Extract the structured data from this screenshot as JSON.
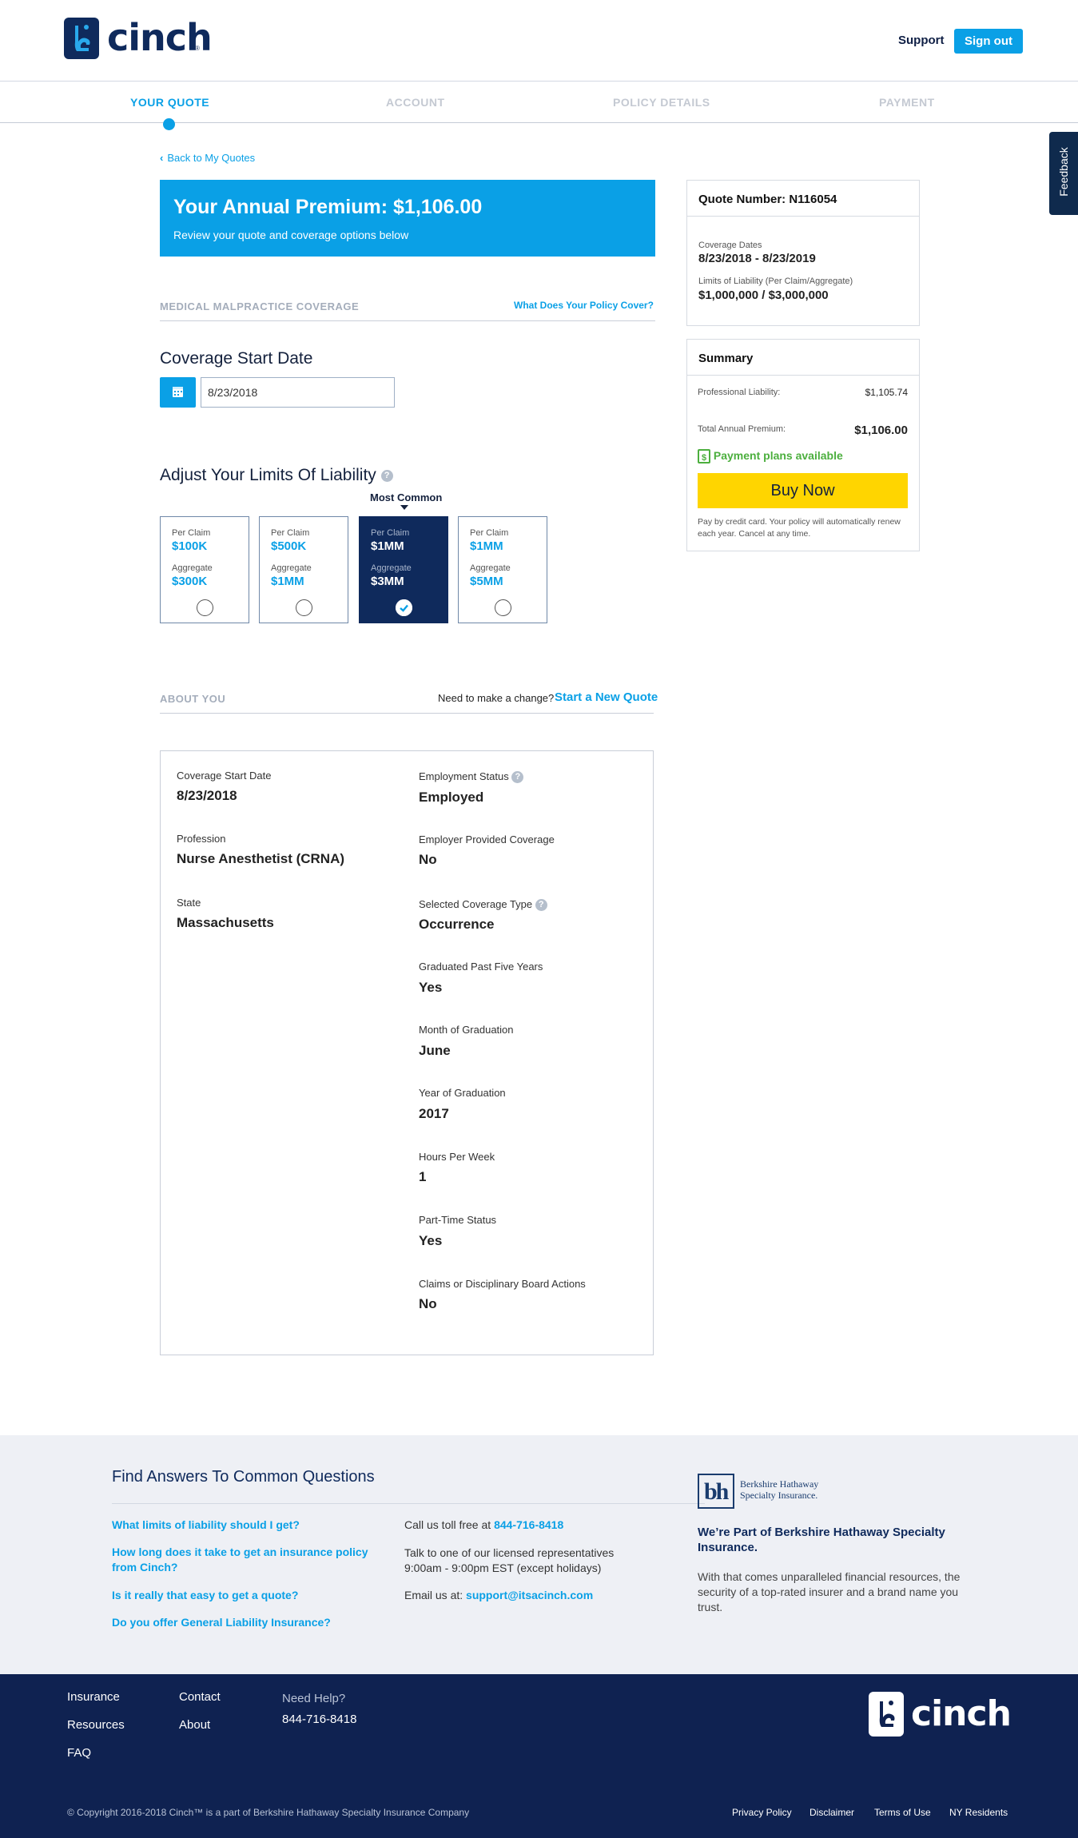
{
  "header": {
    "logo_text": "cinch",
    "logo_tm": "®",
    "support": "Support",
    "sign_out": "Sign out"
  },
  "steps": [
    "YOUR QUOTE",
    "ACCOUNT",
    "POLICY DETAILS",
    "PAYMENT"
  ],
  "feedback": "Feedback",
  "main": {
    "back": "Back to My Quotes",
    "premium_title": "Your Annual Premium: $1,106.00",
    "premium_sub": "Review your quote and coverage options below",
    "coverage_section": "MEDICAL MALPRACTICE COVERAGE",
    "policy_cover_link": "What Does Your Policy Cover?",
    "start_date_title": "Coverage Start Date",
    "start_date_value": "8/23/2018",
    "limits_title": "Adjust Your Limits Of Liability",
    "help": "?",
    "most_common": "Most Common",
    "limits": [
      {
        "per_claim_label": "Per Claim",
        "per_claim": "$100K",
        "aggregate_label": "Aggregate",
        "aggregate": "$300K"
      },
      {
        "per_claim_label": "Per Claim",
        "per_claim": "$500K",
        "aggregate_label": "Aggregate",
        "aggregate": "$1MM"
      },
      {
        "per_claim_label": "Per Claim",
        "per_claim": "$1MM",
        "aggregate_label": "Aggregate",
        "aggregate": "$3MM"
      },
      {
        "per_claim_label": "Per Claim",
        "per_claim": "$1MM",
        "aggregate_label": "Aggregate",
        "aggregate": "$5MM"
      }
    ],
    "about_section": "ABOUT YOU",
    "change_text": "Need to make a change?",
    "new_quote_link": "Start a New Quote"
  },
  "about": {
    "left": [
      {
        "label": "Coverage Start Date",
        "value": "8/23/2018"
      },
      {
        "label": "Profession",
        "value": "Nurse Anesthetist (CRNA)"
      },
      {
        "label": "State",
        "value": "Massachusetts"
      }
    ],
    "right": [
      {
        "label": "Employment Status",
        "value": "Employed"
      },
      {
        "label": "Employer Provided Coverage",
        "value": "No"
      },
      {
        "label": "Selected Coverage Type",
        "value": "Occurrence"
      },
      {
        "label": "Graduated Past Five Years",
        "value": "Yes"
      },
      {
        "label": "Month of Graduation",
        "value": "June"
      },
      {
        "label": "Year of Graduation",
        "value": "2017"
      },
      {
        "label": "Hours Per Week",
        "value": "1"
      },
      {
        "label": "Part-Time Status",
        "value": "Yes"
      },
      {
        "label": "Claims or Disciplinary Board Actions",
        "value": "No"
      }
    ]
  },
  "quote": {
    "number": "Quote Number: N116054",
    "dates_label": "Coverage Dates",
    "dates": "8/23/2018 - 8/23/2019",
    "limits_label": "Limits of Liability (Per Claim/Aggregate)",
    "limits": "$1,000,000 / $3,000,000"
  },
  "summary": {
    "title": "Summary",
    "prof_label": "Professional Liability:",
    "prof_value": "$1,105.74",
    "total_label": "Total Annual Premium:",
    "total_value": "$1,106.00",
    "payment_plans": "Payment plans available",
    "buy_now": "Buy Now",
    "note": "Pay by credit card. Your policy will automatically renew each year. Cancel at any time."
  },
  "faq": {
    "title": "Find Answers To Common Questions",
    "questions": [
      "What limits of liability should I get?",
      "How long does it take to get an insurance policy from Cinch?",
      "Is it really that easy to get a quote?",
      "Do you offer General Liability Insurance?"
    ],
    "call_text": "Call us toll free at",
    "phone": "844-716-8418",
    "talk_text": "Talk to one of our licensed representatives 9:00am - 9:00pm EST (except holidays)",
    "email_text": "Email us at:",
    "email": "support@itsacinch.com",
    "bh_logo_line1": "Berkshire Hathaway",
    "bh_logo_line2": "Specialty Insurance.",
    "bh_title": "We’re Part of Berkshire Hathaway Specialty Insurance.",
    "bh_text": "With that comes unparalleled financial resources, the security of a top-rated insurer and a brand name you trust."
  },
  "footer": {
    "links_col1": [
      "Insurance",
      "Resources",
      "FAQ"
    ],
    "links_col2": [
      "Contact",
      "About"
    ],
    "need_help": "Need Help?",
    "phone": "844-716-8418",
    "logo_text": "cinch",
    "copyright": "© Copyright 2016-2018 Cinch™ is a part of Berkshire Hathaway Specialty Insurance Company",
    "legal": [
      "Privacy Policy",
      "Disclaimer",
      "Terms of Use",
      "NY Residents"
    ]
  }
}
